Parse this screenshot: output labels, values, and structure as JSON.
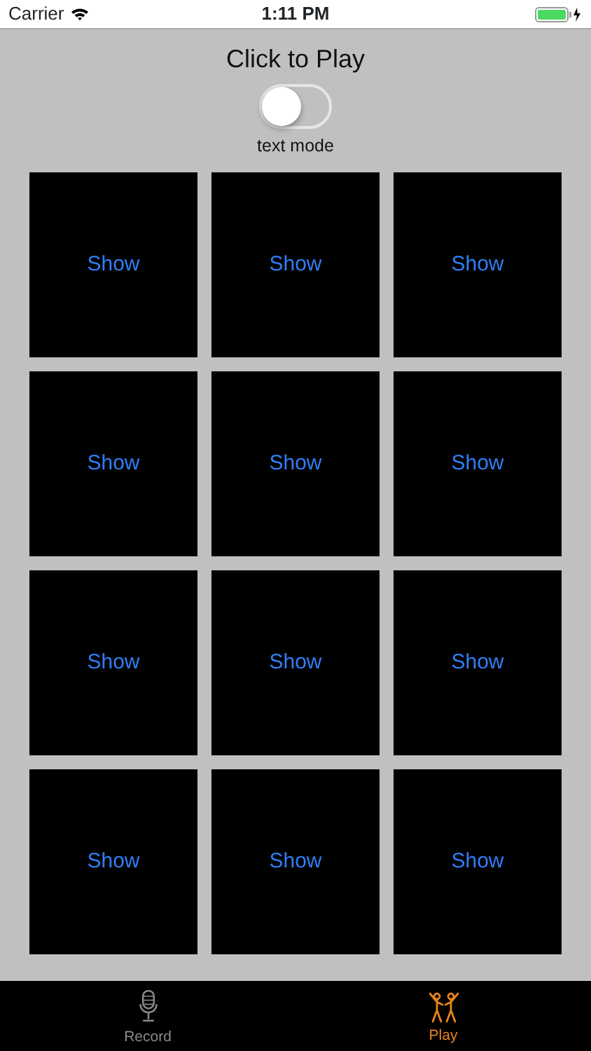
{
  "status_bar": {
    "carrier": "Carrier",
    "time": "1:11 PM"
  },
  "title": "Click to Play",
  "text_mode_switch": {
    "label": "text mode",
    "on": false
  },
  "tiles": [
    {
      "label": "Show"
    },
    {
      "label": "Show"
    },
    {
      "label": "Show"
    },
    {
      "label": "Show"
    },
    {
      "label": "Show"
    },
    {
      "label": "Show"
    },
    {
      "label": "Show"
    },
    {
      "label": "Show"
    },
    {
      "label": "Show"
    },
    {
      "label": "Show"
    },
    {
      "label": "Show"
    },
    {
      "label": "Show"
    }
  ],
  "tab_bar": [
    {
      "label": "Record",
      "kind": "microphone",
      "selected": false
    },
    {
      "label": "Play",
      "kind": "dancers",
      "selected": true
    }
  ]
}
